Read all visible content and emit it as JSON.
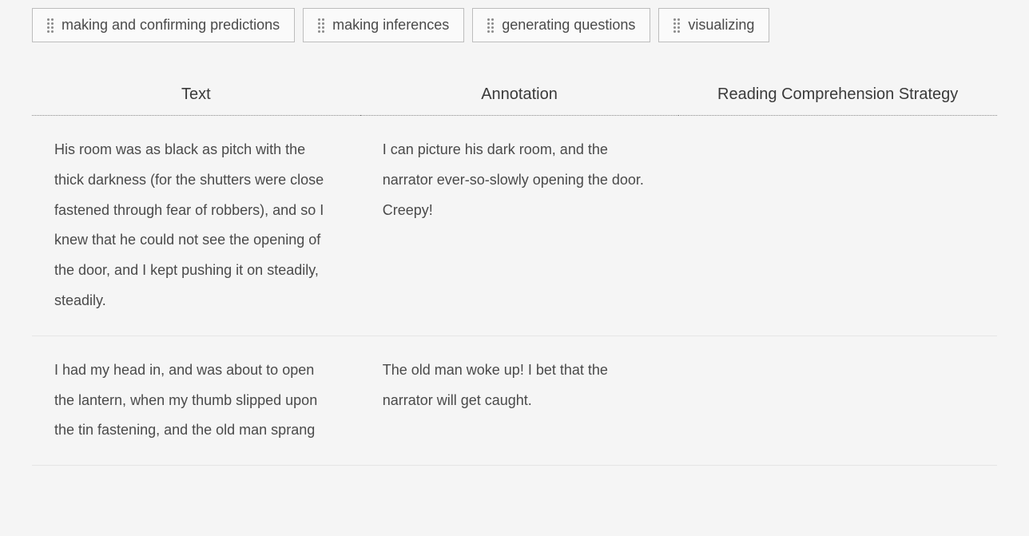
{
  "draggables": [
    {
      "label": "making and confirming predictions"
    },
    {
      "label": "making inferences"
    },
    {
      "label": "generating questions"
    },
    {
      "label": "visualizing"
    }
  ],
  "table": {
    "headers": {
      "col1": "Text",
      "col2": "Annotation",
      "col3": "Reading Comprehension Strategy"
    },
    "rows": [
      {
        "text": "His room was as black as pitch with the thick darkness (for the shutters were close fastened through fear of robbers), and so I knew that he could not see the opening of the door, and I kept pushing it on steadily, steadily.",
        "annotation": "I can picture his dark room, and the narrator ever-so-slowly opening the door. Creepy!",
        "strategy": ""
      },
      {
        "text": "I had my head in, and was about to open the lantern, when my thumb slipped upon the tin fastening, and the old man sprang",
        "annotation": "The old man woke up! I bet that the narrator will get caught.",
        "strategy": ""
      }
    ]
  }
}
